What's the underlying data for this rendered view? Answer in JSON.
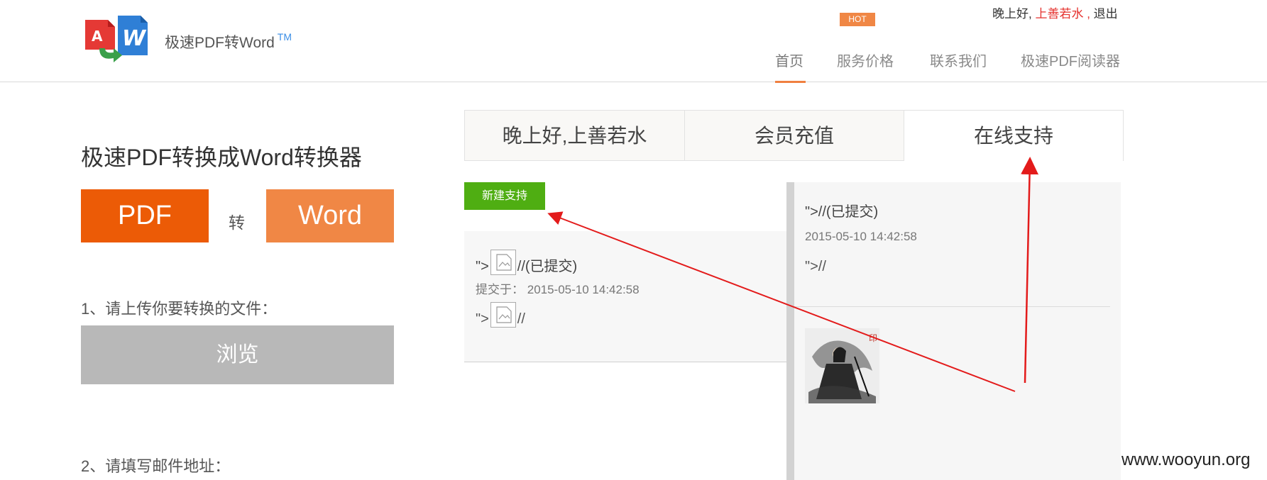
{
  "header": {
    "logo_text": "极速PDF转Word",
    "logo_tm": "TM",
    "greeting_prefix": "晚上好,",
    "username": "上善若水",
    "greeting_sep": ",",
    "logout": "退出",
    "nav": [
      {
        "label": "首页",
        "active": true
      },
      {
        "label": "服务价格",
        "active": false
      },
      {
        "label": "联系我们",
        "active": false
      },
      {
        "label": "极速PDF阅读器",
        "active": false
      }
    ]
  },
  "left": {
    "title": "极速PDF转换成Word转换器",
    "pdf_label": "PDF",
    "to_label": "转",
    "word_label": "Word",
    "step1": "1、请上传你要转换的文件：",
    "browse": "浏览",
    "step2": "2、请填写邮件地址："
  },
  "tabs": [
    {
      "label": "晚上好,上善若水",
      "active": false
    },
    {
      "label": "会员充值",
      "active": false,
      "badge": "HOT"
    },
    {
      "label": "在线支持",
      "active": true
    }
  ],
  "new_support_button": "新建支持",
  "ticket_list": {
    "title_prefix": "\">",
    "title_suffix": "//(已提交)",
    "time_label": "提交于：",
    "time_value": "2015-05-10 14:42:58",
    "body_prefix": "\">",
    "body_suffix": "//"
  },
  "detail": {
    "title": "\">//(已提交)",
    "time": "2015-05-10 14:42:58",
    "body": "\">//"
  },
  "watermark": "www.wooyun.org",
  "colors": {
    "pdf_orange": "#ec5b06",
    "word_orange": "#f08745",
    "green_button": "#4fae12",
    "username_red": "#e5312d",
    "arrow_red": "#e31b1b"
  }
}
